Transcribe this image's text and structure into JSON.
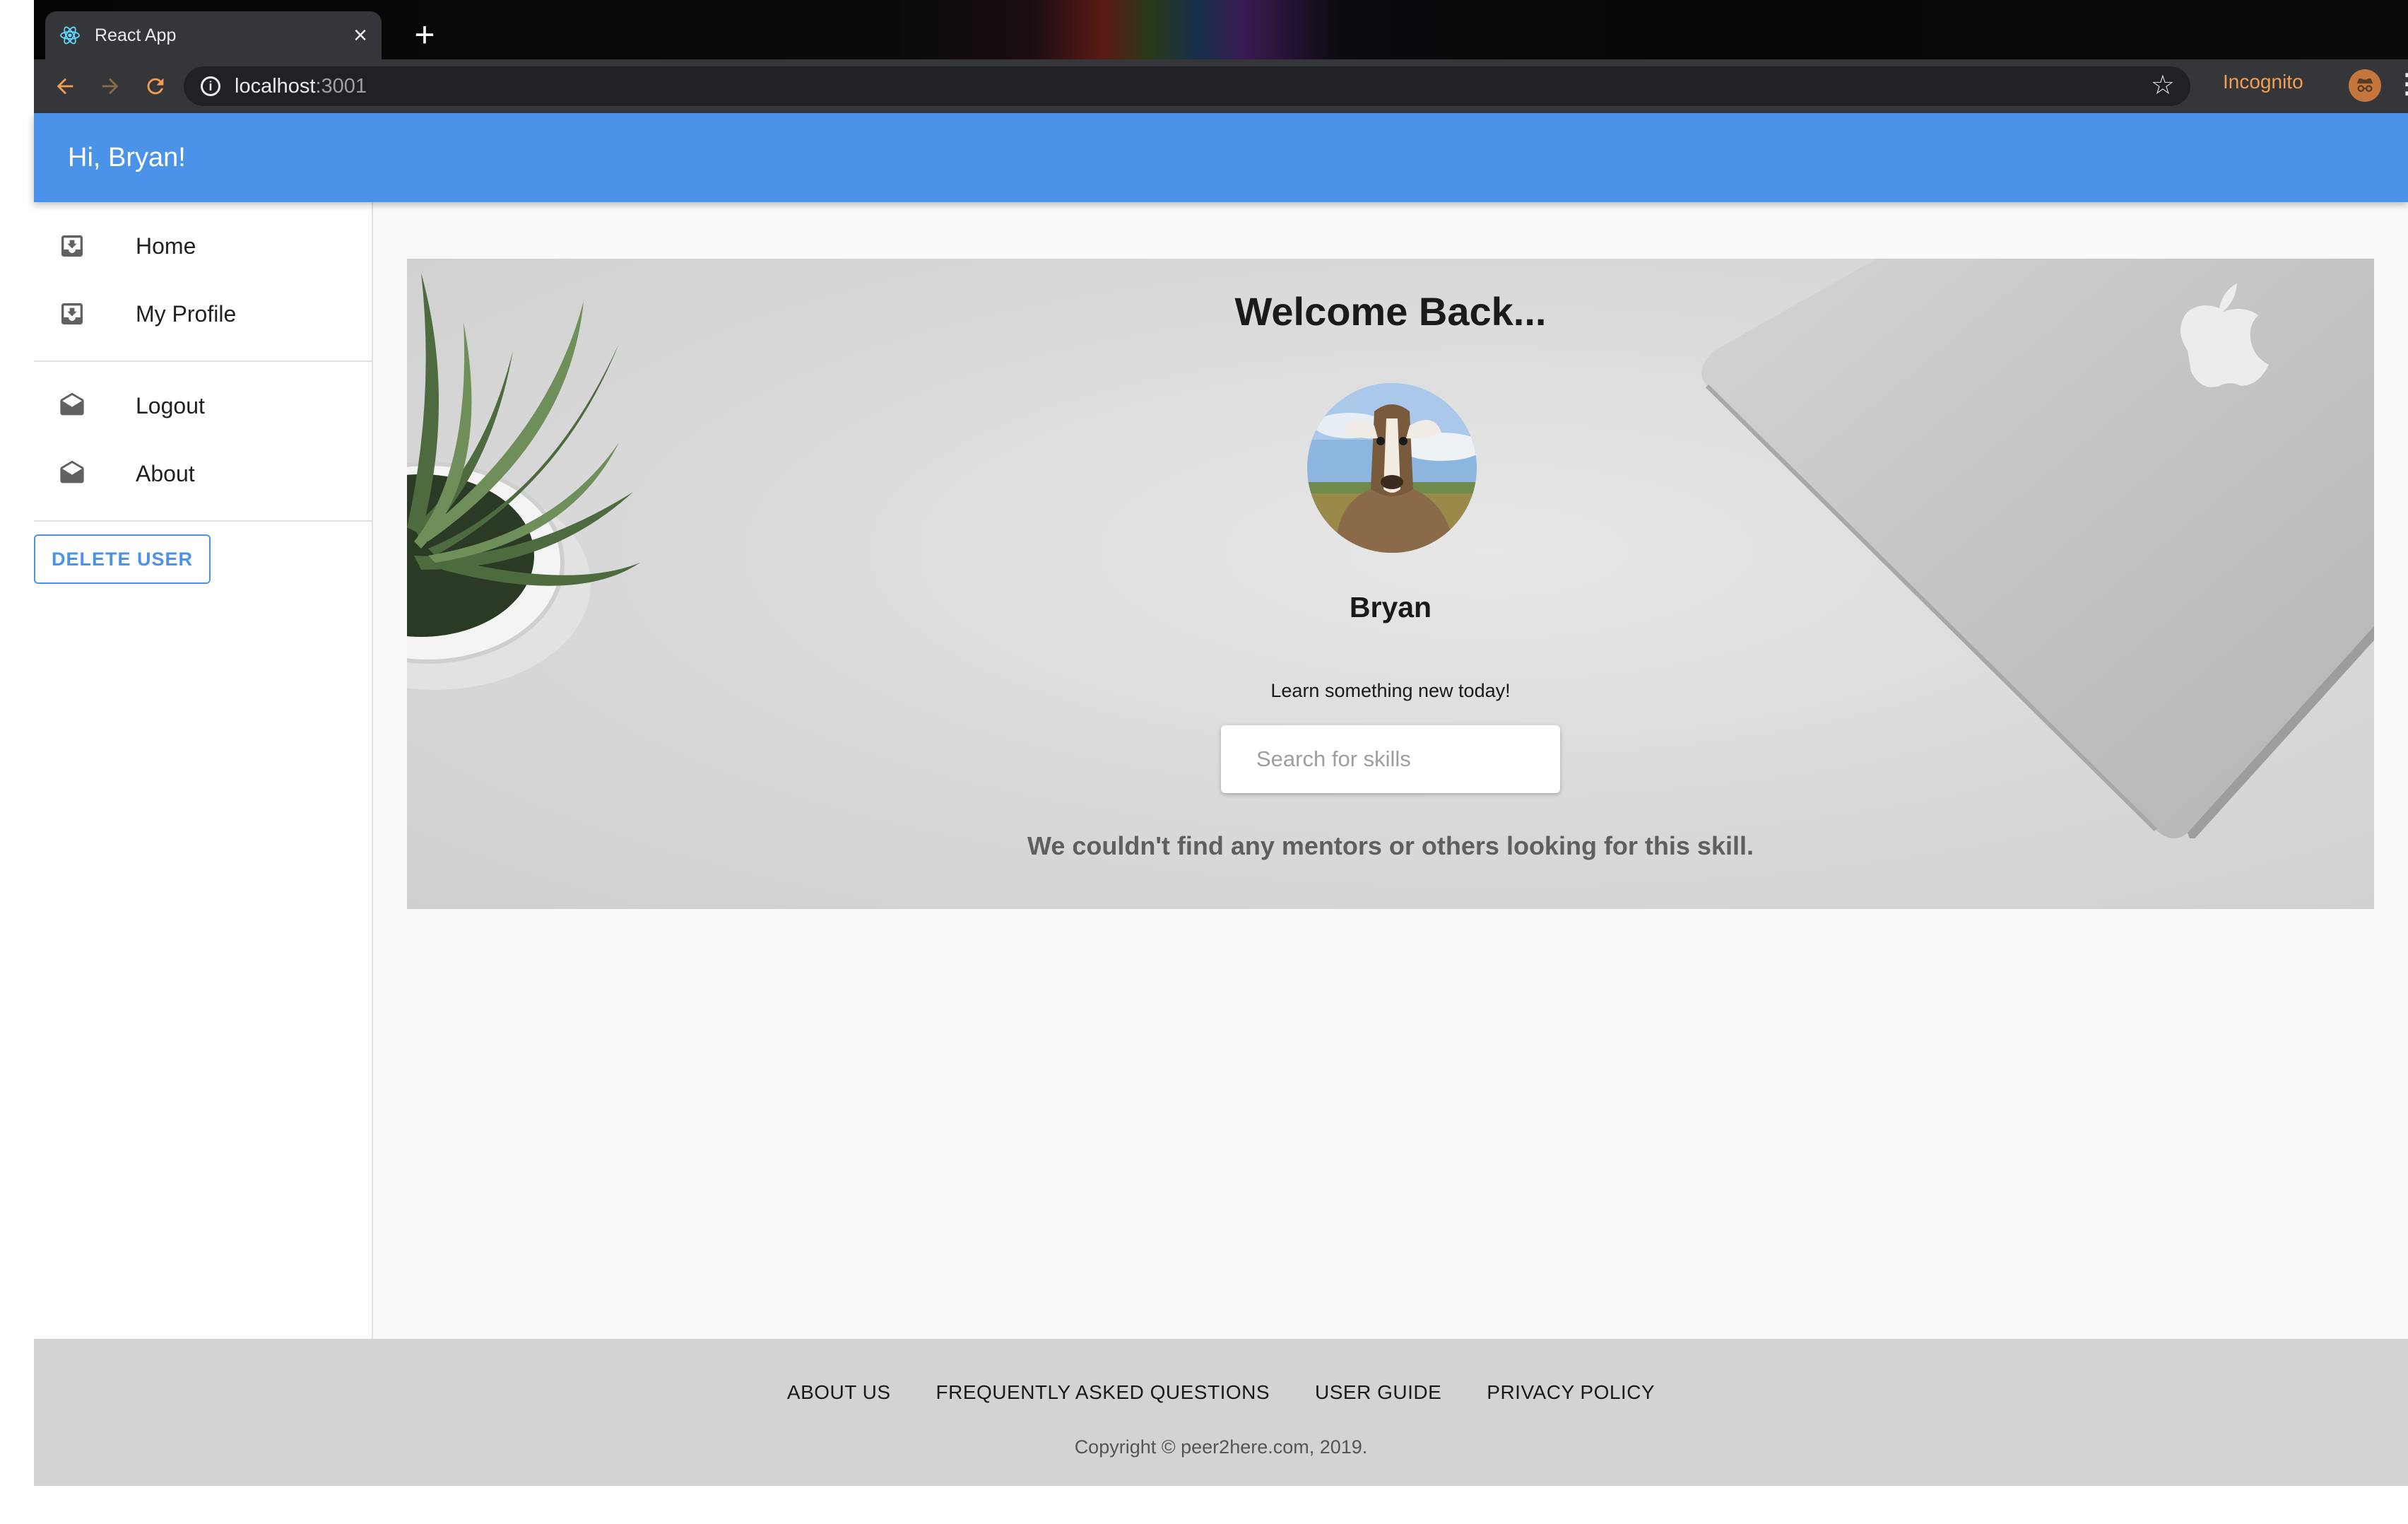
{
  "browser": {
    "tab_title": "React App",
    "tab_close": "×",
    "new_tab": "+",
    "url_host": "localhost",
    "url_port": ":3001",
    "incognito_label": "Incognito",
    "icons": [
      "react-icon",
      "back-arrow-icon",
      "forward-arrow-icon",
      "reload-icon",
      "info-icon",
      "star-icon",
      "incognito-icon",
      "menu-dots-icon"
    ]
  },
  "appbar": {
    "title": "Hi, Bryan!",
    "color": "#4a93e8"
  },
  "sidebar": {
    "items": [
      {
        "label": "Home",
        "icon": "move-to-inbox-icon"
      },
      {
        "label": "My Profile",
        "icon": "move-to-inbox-icon"
      },
      {
        "label": "Logout",
        "icon": "drafts-mail-icon"
      },
      {
        "label": "About",
        "icon": "drafts-mail-icon"
      }
    ],
    "delete_button": "DELETE USER"
  },
  "hero": {
    "title": "Welcome Back...",
    "user_name": "Bryan",
    "tagline": "Learn something new today!",
    "search_placeholder": "Search for skills",
    "no_results": "We couldn't find any mentors or others looking for this skill."
  },
  "footer": {
    "links": [
      "ABOUT US",
      "FREQUENTLY ASKED QUESTIONS",
      "USER GUIDE",
      "PRIVACY POLICY"
    ],
    "copyright": "Copyright © peer2here.com, 2019."
  }
}
